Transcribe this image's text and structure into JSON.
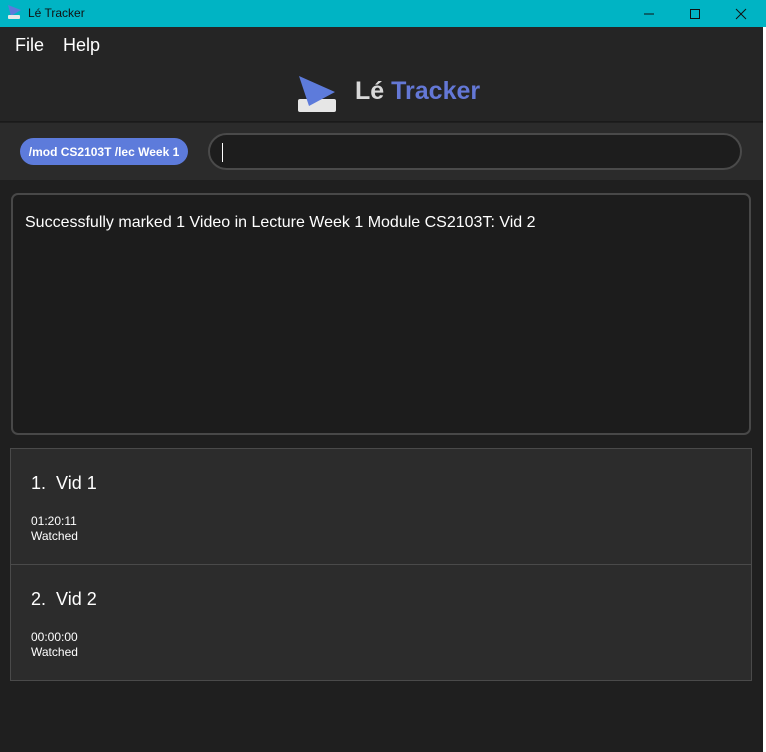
{
  "window": {
    "title": "Lé Tracker",
    "controls": [
      "minimize-icon",
      "maximize-icon",
      "close-icon"
    ]
  },
  "menu": {
    "file": "File",
    "help": "Help"
  },
  "brand": {
    "part1": "Lé",
    "part2": "Tracker",
    "accent_color": "#6478d6"
  },
  "command": {
    "context": "/mod CS2103T /lec Week 1",
    "value": ""
  },
  "result": {
    "message": "Successfully marked 1 Video in Lecture Week 1 Module CS2103T: Vid 2"
  },
  "videos": [
    {
      "index": "1.",
      "name": "Vid 1",
      "duration": "01:20:11",
      "status": "Watched"
    },
    {
      "index": "2.",
      "name": "Vid 2",
      "duration": "00:00:00",
      "status": "Watched"
    }
  ]
}
